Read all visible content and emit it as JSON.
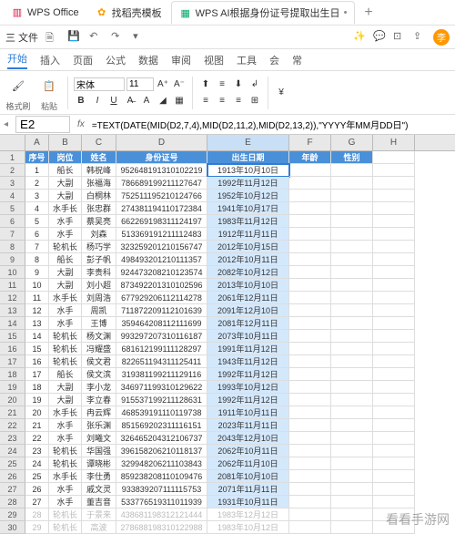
{
  "titlebar": {
    "tabs": [
      {
        "icon": "wps",
        "label": "WPS Office"
      },
      {
        "icon": "star",
        "label": "找稻壳模板"
      },
      {
        "icon": "sheet",
        "label": "WPS AI根据身份证号提取出生日"
      }
    ],
    "add": "+"
  },
  "toptoolbar": {
    "menu": "三 文件"
  },
  "ribbon": {
    "tabs": [
      "开始",
      "插入",
      "页面",
      "公式",
      "数据",
      "审阅",
      "视图",
      "工具",
      "会",
      "常"
    ],
    "active": "开始",
    "format_painter": "格式刷",
    "paste": "粘贴",
    "font": "宋体",
    "size": "11",
    "currency": "¥"
  },
  "formula_bar": {
    "name_box": "E2",
    "fx": "fx",
    "formula": "=TEXT(DATE(MID(D2,7,4),MID(D2,11,2),MID(D2,13,2)),\"YYYY年MM月DD日\")"
  },
  "columns": [
    "A",
    "B",
    "C",
    "D",
    "E",
    "F",
    "G",
    "H"
  ],
  "headers": [
    "序号",
    "岗位",
    "姓名",
    "身份证号",
    "出生日期",
    "年龄",
    "性别"
  ],
  "rows": [
    {
      "n": "1",
      "p": "船长",
      "nm": "韩祝峰",
      "id": "952648191310102219",
      "d": "1913年10月10日"
    },
    {
      "n": "2",
      "p": "大副",
      "nm": "张福海",
      "id": "786689199211127647",
      "d": "1992年11月12日"
    },
    {
      "n": "3",
      "p": "大副",
      "nm": "白桐林",
      "id": "752511195210124766",
      "d": "1952年10月12日"
    },
    {
      "n": "4",
      "p": "水手长",
      "nm": "张忠群",
      "id": "274381194110172384",
      "d": "1941年10月17日"
    },
    {
      "n": "5",
      "p": "水手",
      "nm": "蔡吴亮",
      "id": "662269198311124197",
      "d": "1983年11月12日"
    },
    {
      "n": "6",
      "p": "水手",
      "nm": "刘森",
      "id": "513369191211112483",
      "d": "1912年11月11日"
    },
    {
      "n": "7",
      "p": "轮机长",
      "nm": "杨巧学",
      "id": "323259201210156747",
      "d": "2012年10月15日"
    },
    {
      "n": "8",
      "p": "船长",
      "nm": "彭子帆",
      "id": "498493201210111357",
      "d": "2012年10月11日"
    },
    {
      "n": "9",
      "p": "大副",
      "nm": "李贵科",
      "id": "924473208210123574",
      "d": "2082年10月12日"
    },
    {
      "n": "10",
      "p": "大副",
      "nm": "刘小超",
      "id": "873492201310102596",
      "d": "2013年10月10日"
    },
    {
      "n": "11",
      "p": "水手长",
      "nm": "刘周浩",
      "id": "677929206112114278",
      "d": "2061年12月11日"
    },
    {
      "n": "12",
      "p": "水手",
      "nm": "周凯",
      "id": "711872209112101639",
      "d": "2091年12月10日"
    },
    {
      "n": "13",
      "p": "水手",
      "nm": "王博",
      "id": "359464208112111699",
      "d": "2081年12月11日"
    },
    {
      "n": "14",
      "p": "轮机长",
      "nm": "杨文渊",
      "id": "993297207310116187",
      "d": "2073年10月11日"
    },
    {
      "n": "15",
      "p": "轮机长",
      "nm": "冯耀盛",
      "id": "681612199111128297",
      "d": "1991年11月12日"
    },
    {
      "n": "16",
      "p": "轮机长",
      "nm": "侯文君",
      "id": "822651194311125411",
      "d": "1943年11月12日"
    },
    {
      "n": "17",
      "p": "船长",
      "nm": "侯文滨",
      "id": "319381199211129116",
      "d": "1992年11月12日"
    },
    {
      "n": "18",
      "p": "大副",
      "nm": "李小龙",
      "id": "346971199310129622",
      "d": "1993年10月12日"
    },
    {
      "n": "19",
      "p": "大副",
      "nm": "李立春",
      "id": "915537199211128631",
      "d": "1992年11月12日"
    },
    {
      "n": "20",
      "p": "水手长",
      "nm": "冉云辉",
      "id": "468539191110119738",
      "d": "1911年10月11日"
    },
    {
      "n": "21",
      "p": "水手",
      "nm": "张乐渊",
      "id": "851569202311116151",
      "d": "2023年11月11日"
    },
    {
      "n": "22",
      "p": "水手",
      "nm": "刘曦文",
      "id": "326465204312106737",
      "d": "2043年12月10日"
    },
    {
      "n": "23",
      "p": "轮机长",
      "nm": "华国强",
      "id": "396158206210118137",
      "d": "2062年10月11日"
    },
    {
      "n": "24",
      "p": "轮机长",
      "nm": "谭晓彬",
      "id": "329948206211103843",
      "d": "2062年11月10日"
    },
    {
      "n": "25",
      "p": "水手长",
      "nm": "李仕勇",
      "id": "859238208110109476",
      "d": "2081年10月10日"
    },
    {
      "n": "26",
      "p": "水手",
      "nm": "戚文灵",
      "id": "933839207111115753",
      "d": "2071年11月11日"
    },
    {
      "n": "27",
      "p": "水手",
      "nm": "董吉音",
      "id": "533776519311011939",
      "d": "1931年10月11日"
    },
    {
      "n": "28",
      "p": "轮机长",
      "nm": "于景来",
      "id": "438681198312121444",
      "d": "1983年12月12日"
    },
    {
      "n": "29",
      "p": "轮机长",
      "nm": "高波",
      "id": "278688198310122988",
      "d": "1983年10月12日"
    }
  ],
  "watermark": "看看手游网"
}
